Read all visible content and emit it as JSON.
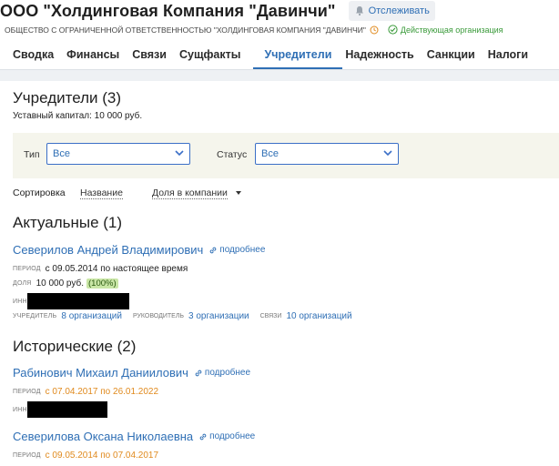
{
  "header": {
    "company_title": "ООО \"Холдинговая Компания \"Давинчи\"",
    "follow_label": "Отслеживать",
    "full_name": "ОБЩЕСТВО С ОГРАНИЧЕННОЙ ОТВЕТСТВЕННОСТЬЮ \"ХОЛДИНГОВАЯ КОМПАНИЯ \"ДАВИНЧИ\"",
    "status": "Действующая организация",
    "status_color": "#3a9a3a"
  },
  "tabs": [
    {
      "label": "Сводка"
    },
    {
      "label": "Финансы"
    },
    {
      "label": "Связи"
    },
    {
      "label": "Сущфакты"
    },
    {
      "label": "Учредители",
      "active": true
    },
    {
      "label": "Надежность"
    },
    {
      "label": "Санкции"
    },
    {
      "label": "Налоги"
    }
  ],
  "founders": {
    "title": "Учредители (3)",
    "capital": "Уставный капитал: 10 000 руб.",
    "filters": {
      "type_label": "Тип",
      "type_value": "Все",
      "status_label": "Статус",
      "status_value": "Все"
    },
    "sort": {
      "label": "Сортировка",
      "by_name": "Название",
      "by_share": "Доля в компании"
    },
    "actual": {
      "title": "Актуальные (1)",
      "items": [
        {
          "name": "Северилов Андрей Владимирович",
          "more": "подробнее",
          "period_label": "период",
          "period": "с 09.05.2014 по настоящее время",
          "share_label": "доля",
          "share_value": "10 000 руб.",
          "share_percent": "(100%)",
          "inn_label": "инн",
          "founder_label": "учредитель",
          "founder_link": "8 организаций",
          "head_label": "руководитель",
          "head_link": "3 организации",
          "links_label": "связи",
          "links_link": "10 организаций"
        }
      ]
    },
    "historical": {
      "title": "Исторические (2)",
      "items": [
        {
          "name": "Рабинович Михаил Даниилович",
          "more": "подробнее",
          "period_label": "период",
          "period": "с 07.04.2017 по 26.01.2022",
          "inn_label": "инн"
        },
        {
          "name": "Северилова Оксана Николаевна",
          "more": "подробнее",
          "period_label": "период",
          "period": "с 09.05.2014 по 07.04.2017"
        }
      ]
    }
  },
  "colors": {
    "accent": "#2f6fb5",
    "historical_period": "#e08a1e",
    "filter_bg": "#f5f5ec"
  }
}
